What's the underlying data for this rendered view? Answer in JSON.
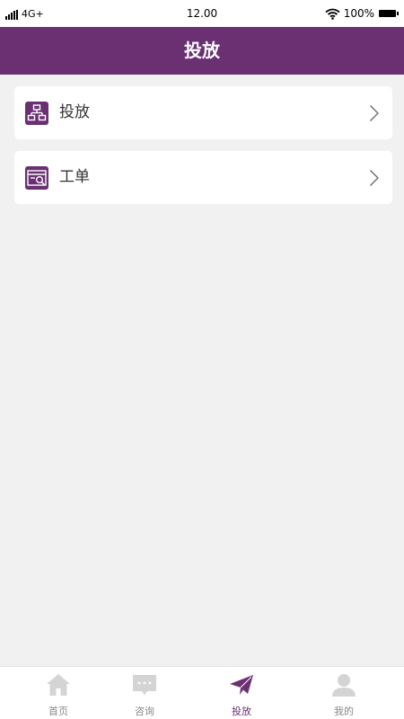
{
  "status_bar": {
    "network": "4G+",
    "time": "12.00",
    "battery": "100%"
  },
  "header": {
    "title": "投放"
  },
  "menu": [
    {
      "label": "投放",
      "icon": "network-diagram-icon"
    },
    {
      "label": "工单",
      "icon": "search-document-icon"
    }
  ],
  "tabs": [
    {
      "label": "首页",
      "icon": "home-icon",
      "active": false
    },
    {
      "label": "咨询",
      "icon": "chat-icon",
      "active": false
    },
    {
      "label": "投放",
      "icon": "paper-plane-icon",
      "active": true
    },
    {
      "label": "我的",
      "icon": "user-icon",
      "active": false
    }
  ],
  "colors": {
    "brand": "#6a3072",
    "background": "#f1f1f1",
    "inactive_tab": "#d4d4d4"
  }
}
